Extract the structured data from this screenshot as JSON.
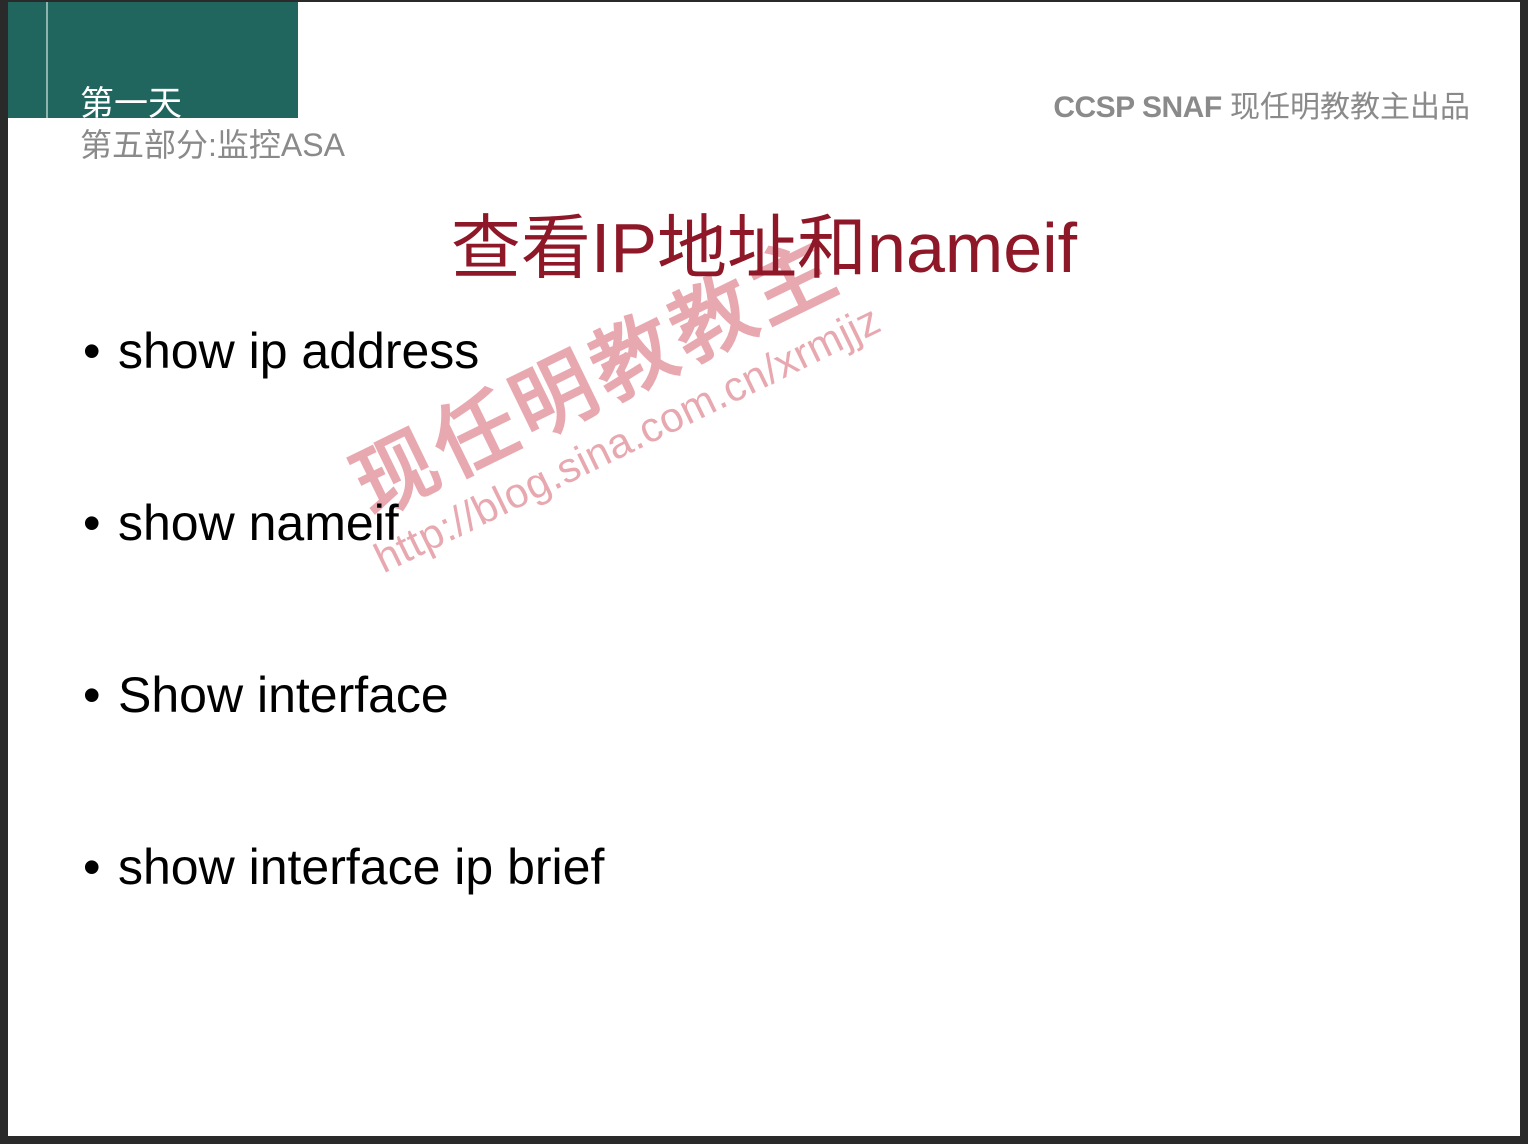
{
  "header": {
    "day": "第一天",
    "section": "第五部分:监控ASA",
    "top_right_bold": "CCSP SNAF",
    "top_right_rest": " 现任明教教主出品"
  },
  "title": {
    "pre": "查看",
    "ip": "IP",
    "mid": "地址和",
    "tail": "nameif"
  },
  "bullets": [
    "show ip address",
    "show nameif",
    "Show interface",
    "show interface ip brief"
  ],
  "watermark": {
    "cn": "现任明教教主",
    "url": "http://blog.sina.com.cn/xrmjjz"
  }
}
